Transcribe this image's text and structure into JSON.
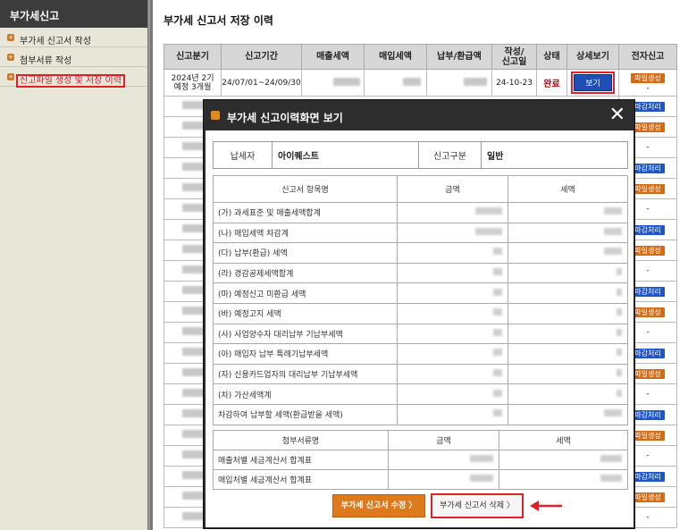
{
  "sidebar": {
    "title": "부가세신고",
    "items": [
      {
        "label": "부가세 신고서 작성"
      },
      {
        "label": "첨부서류 작성"
      },
      {
        "label": "신고파일 생성 및 저장 이력"
      }
    ]
  },
  "main": {
    "title": "부가세 신고서 저장 이력",
    "table": {
      "headers": [
        "신고분기",
        "신고기간",
        "매출세액",
        "매입세액",
        "납부/환급액",
        "작성/\n신고일",
        "상태",
        "상세보기",
        "전자신고"
      ],
      "first_row": {
        "quarter": "2024년 2기\n예정 3개월",
        "period": "24/07/01~24/09/30",
        "date": "24-10-23",
        "status": "완료",
        "view_label": "보기",
        "efile_dash": "-"
      },
      "side_buttons": [
        "파일생성",
        "마감처리",
        "-"
      ]
    }
  },
  "modal": {
    "title": "부가세 신고이력화면 보기",
    "close_label": "✕",
    "taxpayer_label": "납세자",
    "taxpayer_value": "아이퀘스트",
    "report_type_label": "신고구분",
    "report_type_value": "일반",
    "items_headers": [
      "신고서 항목명",
      "금액",
      "세액"
    ],
    "items": [
      "(가) 과세표준 및 매출세액합계",
      "(나) 매입세액 차감계",
      "(다) 납부(환급) 세액",
      "(라) 경감공제세액합계",
      "(마) 예정신고 미환급 세액",
      "(바) 예정고지 세액",
      "(사) 사업양수자 대리납부 기납부세액",
      "(아) 매입자 납부 특례기납부세액",
      "(자) 신용카드업자의 대리납부 기납부세액",
      "(차) 가산세액계",
      "차감하여 납부할 세액(환급받을 세액)"
    ],
    "attachments_headers": [
      "첨부서류명",
      "금액",
      "세액"
    ],
    "attachments": [
      "매출처별 세금계산서 합계표",
      "매입처별 세금계산서 합계표"
    ],
    "edit_button": "부가세 신고서 수정 〉",
    "delete_button": "부가세 신고서 삭제 〉"
  },
  "colors": {
    "highlight": "#e0202a",
    "orange": "#d46a14",
    "blue": "#1f56c7"
  }
}
